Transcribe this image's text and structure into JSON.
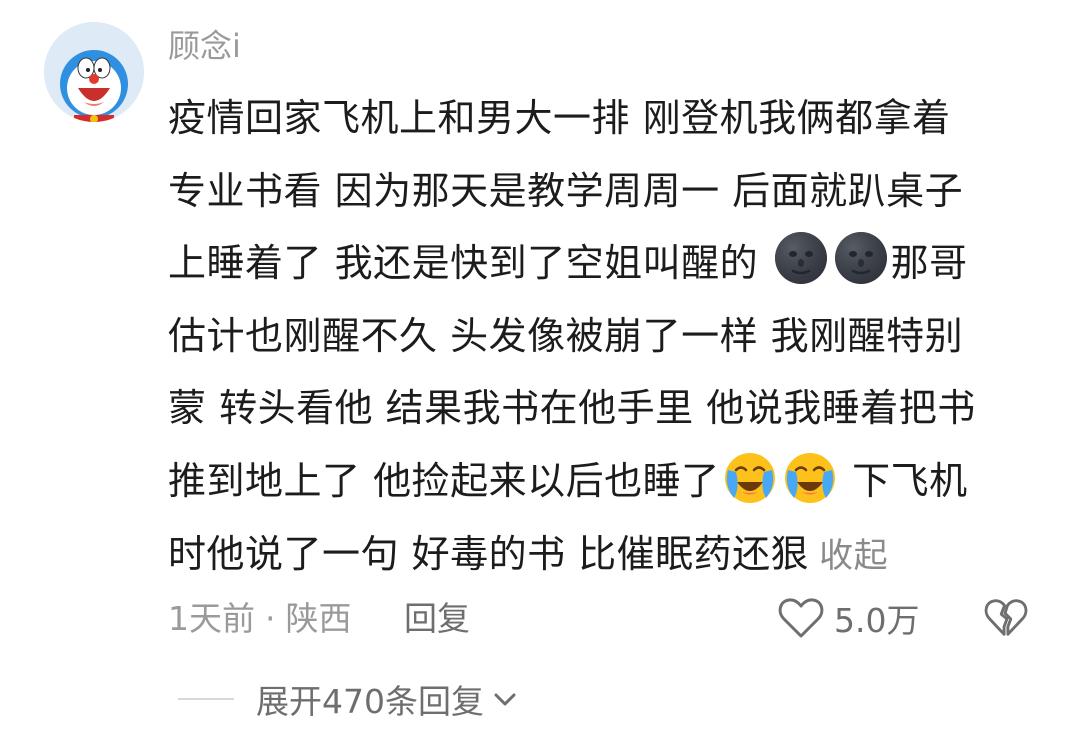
{
  "comment": {
    "username": "顾念i",
    "avatar_icon": "doraemon-avatar-icon",
    "lines": {
      "l1": "疫情回家飞机上和男大一排 刚登机我俩都拿着",
      "l2": "专业书看 因为那天是教学周周一 后面就趴桌子",
      "l3a": "上睡着了 我还是快到了空姐叫醒的 ",
      "l3b": "那哥",
      "l4": "估计也刚醒不久 头发像被崩了一样 我刚醒特别",
      "l5": "蒙 转头看他 结果我书在他手里 他说我睡着把书",
      "l6a": "推到地上了 他捡起来以后也睡了",
      "l6b": " 下飞机",
      "l7": "时他说了一句 好毒的书 比催眠药还狠"
    },
    "emojis": {
      "moon": "new-moon-face-icon",
      "crying": "loudly-crying-laughing-icon"
    },
    "collapse_label": "收起",
    "time": "1天前",
    "separator": "·",
    "location": "陕西",
    "reply_label": "回复",
    "like_count": "5.0万",
    "expand_label": "展开470条回复"
  },
  "colors": {
    "text": "#1c1c1c",
    "muted": "#9a9a9a",
    "secondary": "#6e6e6e"
  }
}
